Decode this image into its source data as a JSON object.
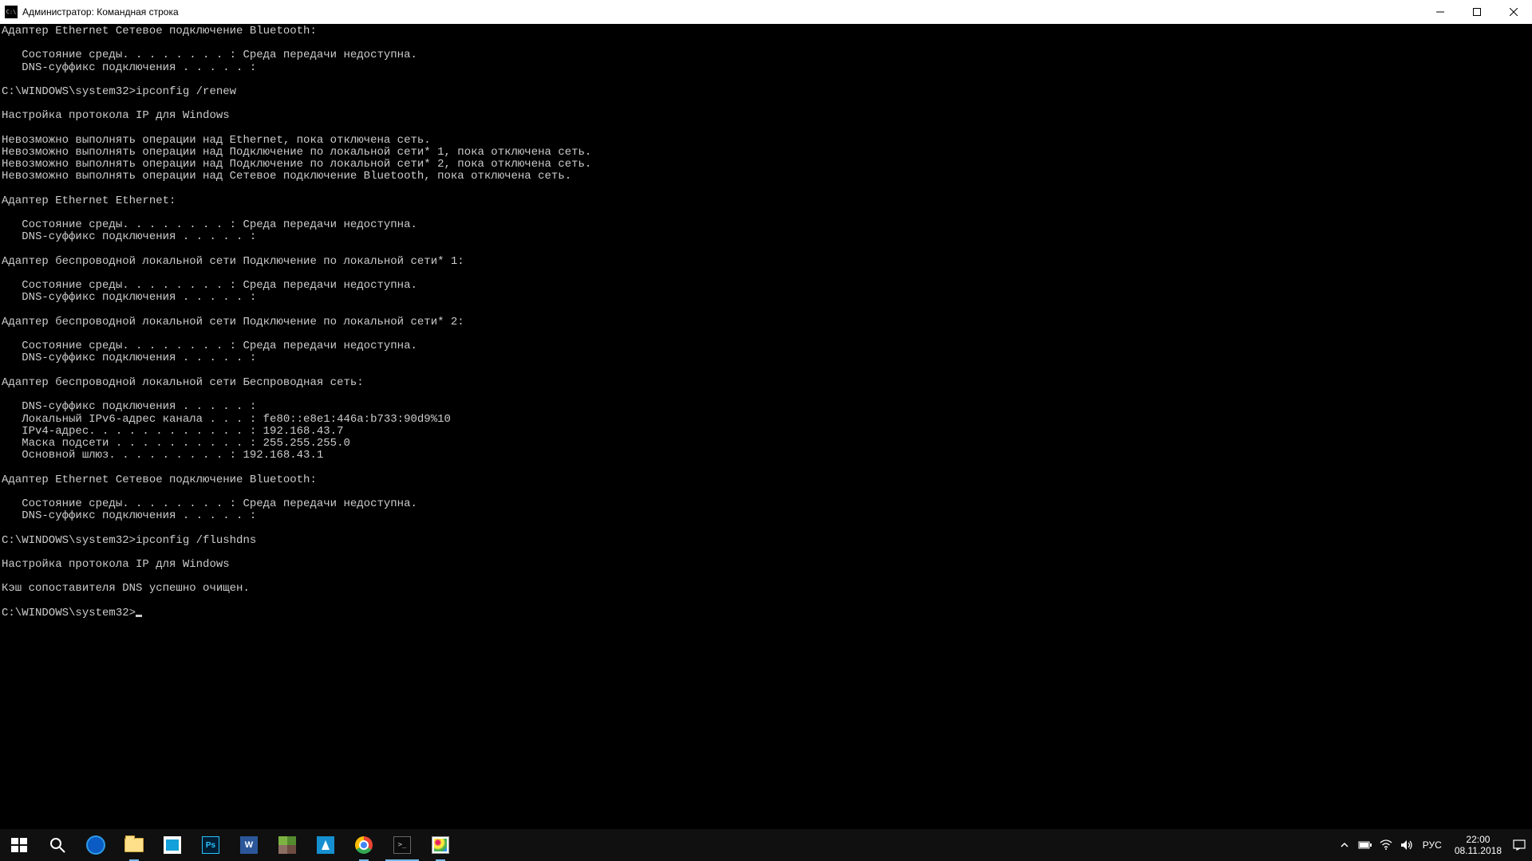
{
  "window": {
    "title": "Администратор: Командная строка"
  },
  "terminal": {
    "lines": [
      "Адаптер Ethernet Сетевое подключение Bluetooth:",
      "",
      "   Состояние среды. . . . . . . . : Среда передачи недоступна.",
      "   DNS-суффикс подключения . . . . . :",
      "",
      "C:\\WINDOWS\\system32>ipconfig /renew",
      "",
      "Настройка протокола IP для Windows",
      "",
      "Невозможно выполнять операции над Ethernet, пока отключена сеть.",
      "Невозможно выполнять операции над Подключение по локальной сети* 1, пока отключена сеть.",
      "Невозможно выполнять операции над Подключение по локальной сети* 2, пока отключена сеть.",
      "Невозможно выполнять операции над Сетевое подключение Bluetooth, пока отключена сеть.",
      "",
      "Адаптер Ethernet Ethernet:",
      "",
      "   Состояние среды. . . . . . . . : Среда передачи недоступна.",
      "   DNS-суффикс подключения . . . . . :",
      "",
      "Адаптер беспроводной локальной сети Подключение по локальной сети* 1:",
      "",
      "   Состояние среды. . . . . . . . : Среда передачи недоступна.",
      "   DNS-суффикс подключения . . . . . :",
      "",
      "Адаптер беспроводной локальной сети Подключение по локальной сети* 2:",
      "",
      "   Состояние среды. . . . . . . . : Среда передачи недоступна.",
      "   DNS-суффикс подключения . . . . . :",
      "",
      "Адаптер беспроводной локальной сети Беспроводная сеть:",
      "",
      "   DNS-суффикс подключения . . . . . :",
      "   Локальный IPv6-адрес канала . . . : fe80::e8e1:446a:b733:90d9%10",
      "   IPv4-адрес. . . . . . . . . . . . : 192.168.43.7",
      "   Маска подсети . . . . . . . . . . : 255.255.255.0",
      "   Основной шлюз. . . . . . . . . : 192.168.43.1",
      "",
      "Адаптер Ethernet Сетевое подключение Bluetooth:",
      "",
      "   Состояние среды. . . . . . . . : Среда передачи недоступна.",
      "   DNS-суффикс подключения . . . . . :",
      "",
      "C:\\WINDOWS\\system32>ipconfig /flushdns",
      "",
      "Настройка протокола IP для Windows",
      "",
      "Кэш сопоставителя DNS успешно очищен.",
      "",
      "C:\\WINDOWS\\system32>"
    ]
  },
  "taskbar": {
    "apps": [
      {
        "name": "start",
        "label": "Start"
      },
      {
        "name": "search",
        "label": "Search"
      },
      {
        "name": "edge",
        "label": "Microsoft Edge"
      },
      {
        "name": "explorer",
        "label": "File Explorer",
        "running": true
      },
      {
        "name": "store",
        "label": "Microsoft Store"
      },
      {
        "name": "photoshop",
        "label": "Photoshop",
        "text": "Ps"
      },
      {
        "name": "word",
        "label": "Word",
        "text": "W"
      },
      {
        "name": "minecraft",
        "label": "Minecraft"
      },
      {
        "name": "vegas",
        "label": "Vegas"
      },
      {
        "name": "chrome",
        "label": "Chrome",
        "running": true
      },
      {
        "name": "cmd",
        "label": "Command Prompt",
        "text": ">_",
        "running": true,
        "active": true
      },
      {
        "name": "paint",
        "label": "Paint",
        "running": true
      }
    ],
    "tray": {
      "lang": "РУС",
      "time": "22:00",
      "date": "08.11.2018"
    }
  }
}
